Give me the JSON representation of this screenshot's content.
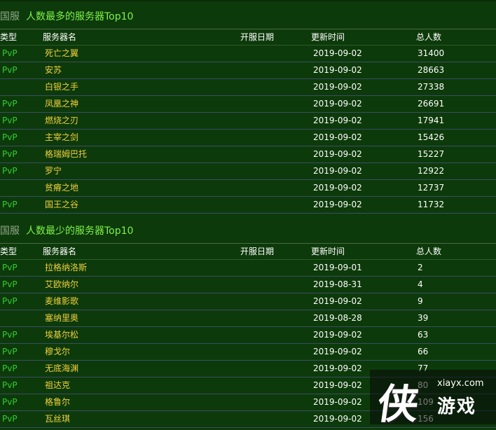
{
  "headers": {
    "type": "类型",
    "server": "服务器名",
    "open_date": "开服日期",
    "update_time": "更新时间",
    "total": "总人数"
  },
  "top": {
    "region": "国服",
    "title": "人数最多的服务器Top10",
    "rows": [
      {
        "type": "PvP",
        "name": "死亡之翼",
        "update": "2019-09-02",
        "total": "31400"
      },
      {
        "type": "PvP",
        "name": "安苏",
        "update": "2019-09-02",
        "total": "28663"
      },
      {
        "type": "",
        "name": "白银之手",
        "update": "2019-09-02",
        "total": "27338"
      },
      {
        "type": "PvP",
        "name": "凤凰之神",
        "update": "2019-09-02",
        "total": "26691"
      },
      {
        "type": "PvP",
        "name": "燃烧之刃",
        "update": "2019-09-02",
        "total": "17941"
      },
      {
        "type": "PvP",
        "name": "主宰之剑",
        "update": "2019-09-02",
        "total": "15426"
      },
      {
        "type": "PvP",
        "name": "格瑞姆巴托",
        "update": "2019-09-02",
        "total": "15227"
      },
      {
        "type": "PvP",
        "name": "罗宁",
        "update": "2019-09-02",
        "total": "12922"
      },
      {
        "type": "",
        "name": "贫瘠之地",
        "update": "2019-09-02",
        "total": "12737"
      },
      {
        "type": "PvP",
        "name": "国王之谷",
        "update": "2019-09-02",
        "total": "11732"
      }
    ]
  },
  "bottom": {
    "region": "国服",
    "title": "人数最少的服务器Top10",
    "rows": [
      {
        "type": "PvP",
        "name": "拉格纳洛斯",
        "update": "2019-09-01",
        "total": "2"
      },
      {
        "type": "PvP",
        "name": "艾欧纳尔",
        "update": "2019-08-31",
        "total": "4"
      },
      {
        "type": "PvP",
        "name": "麦维影歌",
        "update": "2019-09-02",
        "total": "9"
      },
      {
        "type": "",
        "name": "塞纳里奥",
        "update": "2019-08-28",
        "total": "39"
      },
      {
        "type": "PvP",
        "name": "埃基尔松",
        "update": "2019-09-02",
        "total": "63"
      },
      {
        "type": "PvP",
        "name": "穆戈尔",
        "update": "2019-09-02",
        "total": "66"
      },
      {
        "type": "PvP",
        "name": "无底海渊",
        "update": "2019-09-02",
        "total": "77"
      },
      {
        "type": "PvP",
        "name": "祖达克",
        "update": "2019-09-02",
        "total": "80"
      },
      {
        "type": "PvP",
        "name": "格鲁尔",
        "update": "2019-09-02",
        "total": "109"
      },
      {
        "type": "PvP",
        "name": "瓦丝琪",
        "update": "2019-09-02",
        "total": "156"
      }
    ]
  },
  "watermark": {
    "logo_char": "侠",
    "url": "xiayx.com",
    "text": "游戏"
  }
}
